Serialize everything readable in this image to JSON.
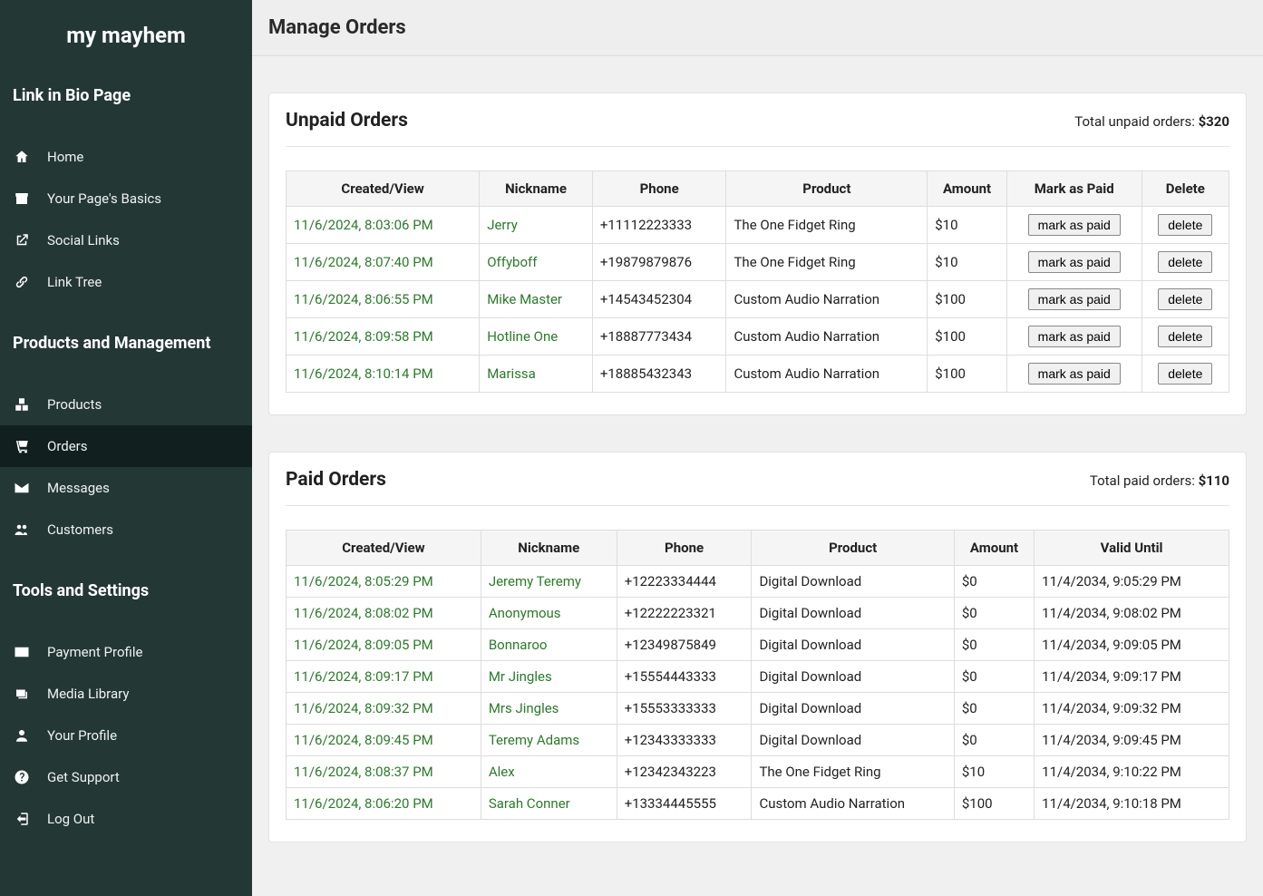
{
  "brand": "my mayhem",
  "nav": {
    "section1": {
      "title": "Link in Bio Page",
      "items": [
        {
          "icon": "home",
          "label": "Home"
        },
        {
          "icon": "store",
          "label": "Your Page's Basics"
        },
        {
          "icon": "share",
          "label": "Social Links"
        },
        {
          "icon": "link",
          "label": "Link Tree"
        }
      ]
    },
    "section2": {
      "title": "Products and Management",
      "items": [
        {
          "icon": "boxes",
          "label": "Products"
        },
        {
          "icon": "cart",
          "label": "Orders",
          "active": true
        },
        {
          "icon": "envelope",
          "label": "Messages"
        },
        {
          "icon": "users",
          "label": "Customers"
        }
      ]
    },
    "section3": {
      "title": "Tools and Settings",
      "items": [
        {
          "icon": "card",
          "label": "Payment Profile"
        },
        {
          "icon": "images",
          "label": "Media Library"
        },
        {
          "icon": "person",
          "label": "Your Profile"
        },
        {
          "icon": "question",
          "label": "Get Support"
        },
        {
          "icon": "logout",
          "label": "Log Out"
        }
      ]
    }
  },
  "page": {
    "title": "Manage Orders"
  },
  "unpaid": {
    "title": "Unpaid Orders",
    "total_label": "Total unpaid orders: ",
    "total_amount": "$320",
    "columns": [
      "Created/View",
      "Nickname",
      "Phone",
      "Product",
      "Amount",
      "Mark as Paid",
      "Delete"
    ],
    "mark_label": "mark as paid",
    "delete_label": "delete",
    "rows": [
      {
        "created": "11/6/2024, 8:03:06 PM",
        "nickname": "Jerry",
        "phone": "+11112223333",
        "product": "The One Fidget Ring",
        "amount": "$10"
      },
      {
        "created": "11/6/2024, 8:07:40 PM",
        "nickname": "Offyboff",
        "phone": "+19879879876",
        "product": "The One Fidget Ring",
        "amount": "$10"
      },
      {
        "created": "11/6/2024, 8:06:55 PM",
        "nickname": "Mike Master",
        "phone": "+14543452304",
        "product": "Custom Audio Narration",
        "amount": "$100"
      },
      {
        "created": "11/6/2024, 8:09:58 PM",
        "nickname": "Hotline One",
        "phone": "+18887773434",
        "product": "Custom Audio Narration",
        "amount": "$100"
      },
      {
        "created": "11/6/2024, 8:10:14 PM",
        "nickname": "Marissa",
        "phone": "+18885432343",
        "product": "Custom Audio Narration",
        "amount": "$100"
      }
    ]
  },
  "paid": {
    "title": "Paid Orders",
    "total_label": "Total paid orders: ",
    "total_amount": "$110",
    "columns": [
      "Created/View",
      "Nickname",
      "Phone",
      "Product",
      "Amount",
      "Valid Until"
    ],
    "rows": [
      {
        "created": "11/6/2024, 8:05:29 PM",
        "nickname": "Jeremy Teremy",
        "phone": "+12223334444",
        "product": "Digital Download",
        "amount": "$0",
        "valid": "11/4/2034, 9:05:29 PM"
      },
      {
        "created": "11/6/2024, 8:08:02 PM",
        "nickname": "Anonymous",
        "phone": "+12222223321",
        "product": "Digital Download",
        "amount": "$0",
        "valid": "11/4/2034, 9:08:02 PM"
      },
      {
        "created": "11/6/2024, 8:09:05 PM",
        "nickname": "Bonnaroo",
        "phone": "+12349875849",
        "product": "Digital Download",
        "amount": "$0",
        "valid": "11/4/2034, 9:09:05 PM"
      },
      {
        "created": "11/6/2024, 8:09:17 PM",
        "nickname": "Mr Jingles",
        "phone": "+15554443333",
        "product": "Digital Download",
        "amount": "$0",
        "valid": "11/4/2034, 9:09:17 PM"
      },
      {
        "created": "11/6/2024, 8:09:32 PM",
        "nickname": "Mrs Jingles",
        "phone": "+15553333333",
        "product": "Digital Download",
        "amount": "$0",
        "valid": "11/4/2034, 9:09:32 PM"
      },
      {
        "created": "11/6/2024, 8:09:45 PM",
        "nickname": "Teremy Adams",
        "phone": "+12343333333",
        "product": "Digital Download",
        "amount": "$0",
        "valid": "11/4/2034, 9:09:45 PM"
      },
      {
        "created": "11/6/2024, 8:08:37 PM",
        "nickname": "Alex",
        "phone": "+12342343223",
        "product": "The One Fidget Ring",
        "amount": "$10",
        "valid": "11/4/2034, 9:10:22 PM"
      },
      {
        "created": "11/6/2024, 8:06:20 PM",
        "nickname": "Sarah Conner",
        "phone": "+13334445555",
        "product": "Custom Audio Narration",
        "amount": "$100",
        "valid": "11/4/2034, 9:10:18 PM"
      }
    ]
  }
}
